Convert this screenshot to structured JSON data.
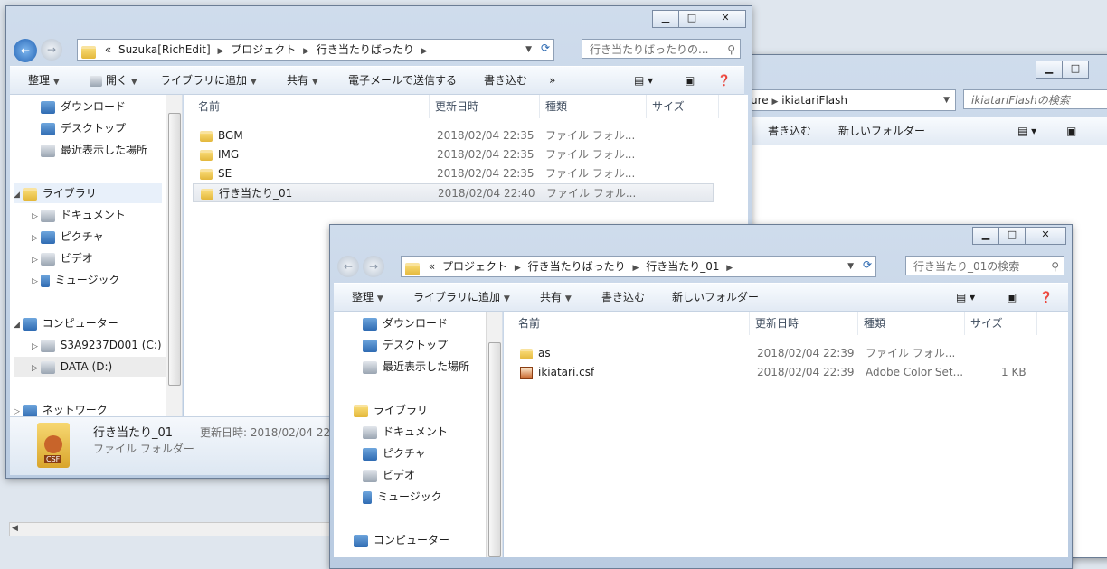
{
  "bg_window": {
    "breadcrumb_tail": "ure",
    "breadcrumb_last": "ikiatariFlash",
    "search_placeholder": "ikiatariFlashの検索",
    "toolbar": [
      "書き込む",
      "新しいフォルダー"
    ]
  },
  "win1": {
    "address": {
      "prefix": "«",
      "crumbs": [
        "Suzuka[RichEdit]",
        "プロジェクト",
        "行き当たりばったり"
      ]
    },
    "search_placeholder": "行き当たりばったりの...",
    "toolbar": {
      "organize": "整理",
      "open": "開く",
      "add_library": "ライブラリに追加",
      "share": "共有",
      "email": "電子メールで送信する",
      "burn": "書き込む",
      "more": "»"
    },
    "nav": {
      "favorites": [
        "ダウンロード",
        "デスクトップ",
        "最近表示した場所"
      ],
      "library": "ライブラリ",
      "library_items": [
        "ドキュメント",
        "ピクチャ",
        "ビデオ",
        "ミュージック"
      ],
      "computer": "コンピューター",
      "drives": [
        "S3A9237D001 (C:)",
        "DATA (D:)"
      ],
      "network": "ネットワーク"
    },
    "columns": [
      "名前",
      "更新日時",
      "種類",
      "サイズ"
    ],
    "files": [
      {
        "name": "BGM",
        "date": "2018/02/04 22:35",
        "type": "ファイル フォル..."
      },
      {
        "name": "IMG",
        "date": "2018/02/04 22:35",
        "type": "ファイル フォル..."
      },
      {
        "name": "SE",
        "date": "2018/02/04 22:35",
        "type": "ファイル フォル..."
      },
      {
        "name": "行き当たり_01",
        "date": "2018/02/04 22:40",
        "type": "ファイル フォル..."
      }
    ],
    "details": {
      "name": "行き当たり_01",
      "type": "ファイル フォルダー",
      "modified": "更新日時: 2018/02/04 22:"
    }
  },
  "win2": {
    "address": {
      "prefix": "«",
      "crumbs": [
        "プロジェクト",
        "行き当たりばったり",
        "行き当たり_01"
      ]
    },
    "search_placeholder": "行き当たり_01の検索",
    "toolbar": {
      "organize": "整理",
      "add_library": "ライブラリに追加",
      "share": "共有",
      "burn": "書き込む",
      "new_folder": "新しいフォルダー"
    },
    "nav": {
      "favorites": [
        "ダウンロード",
        "デスクトップ",
        "最近表示した場所"
      ],
      "library": "ライブラリ",
      "library_items": [
        "ドキュメント",
        "ピクチャ",
        "ビデオ",
        "ミュージック"
      ],
      "computer": "コンピューター"
    },
    "columns": [
      "名前",
      "更新日時",
      "種類",
      "サイズ"
    ],
    "files": [
      {
        "name": "as",
        "date": "2018/02/04 22:39",
        "type": "ファイル フォル...",
        "size": ""
      },
      {
        "name": "ikiatari.csf",
        "date": "2018/02/04 22:39",
        "type": "Adobe Color Set...",
        "size": "1 KB"
      }
    ]
  },
  "colors": {
    "accent": "#2f6bb2",
    "folder": "#e3b73b"
  }
}
